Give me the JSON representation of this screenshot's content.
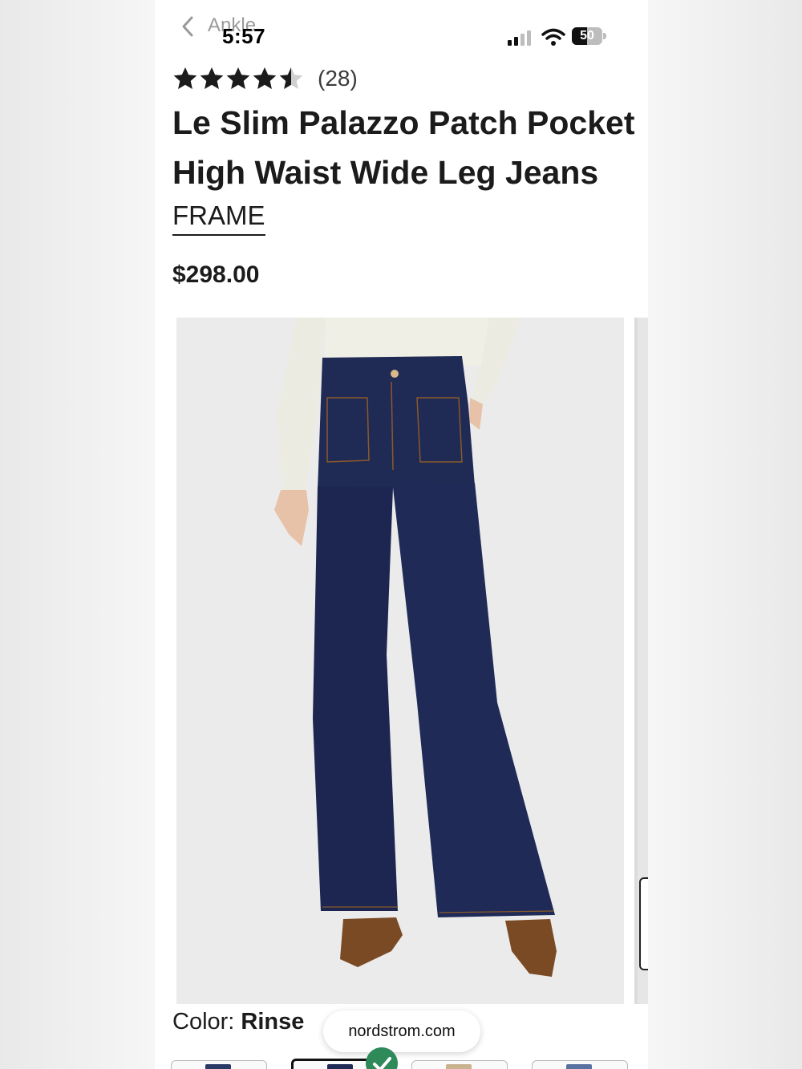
{
  "status_bar": {
    "back_text": "Ankle",
    "time": "5:57",
    "battery": "50",
    "battery_level": 0.5
  },
  "product": {
    "rating": 4.5,
    "review_count": "(28)",
    "title": "Le Slim Palazzo Patch Pocket High Waist Wide Leg Jeans",
    "brand": "FRAME",
    "price": "$298.00"
  },
  "color_selector": {
    "label": "Color:",
    "selected": "Rinse"
  },
  "browser": {
    "url": "nordstrom.com"
  },
  "colors": {
    "denim_dark": "#1f2a55",
    "accent_green": "#2f8a5a",
    "star": "#1b1b1b"
  }
}
